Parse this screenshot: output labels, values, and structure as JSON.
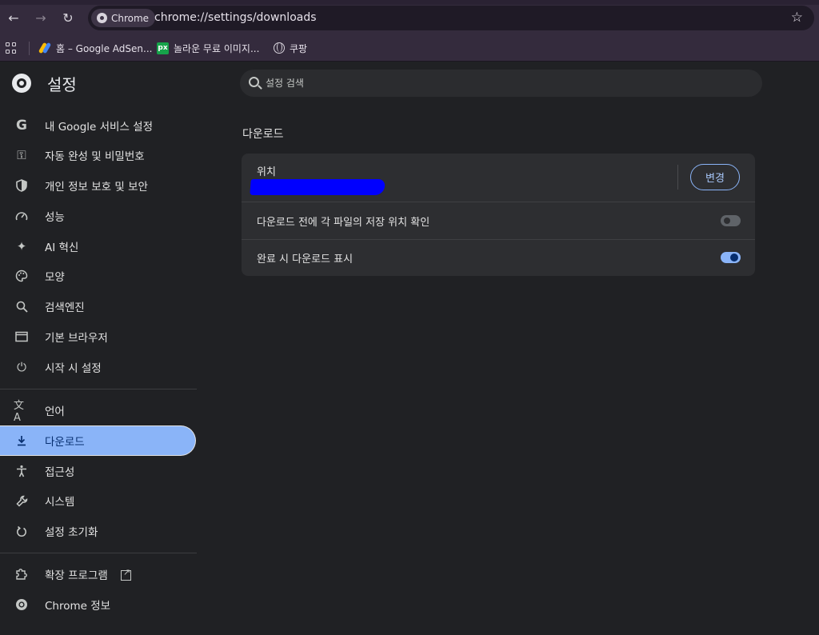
{
  "browser": {
    "chip_label": "Chrome",
    "url": "chrome://settings/downloads",
    "bookmarks": [
      {
        "label": "홈 – Google AdSen...",
        "icon": "google-adsense-icon"
      },
      {
        "label": "놀라운 무료 이미지...",
        "icon": "pixabay-icon",
        "icon_text": "px"
      },
      {
        "label": "쿠팡",
        "icon": "globe-icon"
      }
    ]
  },
  "settings": {
    "title": "설정",
    "search_placeholder": "설정 검색",
    "nav": [
      {
        "label": "내 Google 서비스 설정",
        "icon": "google-icon"
      },
      {
        "label": "자동 완성 및 비밀번호",
        "icon": "key-icon"
      },
      {
        "label": "개인 정보 보호 및 보안",
        "icon": "shield-icon"
      },
      {
        "label": "성능",
        "icon": "speedometer-icon"
      },
      {
        "label": "AI 혁신",
        "icon": "sparkle-icon"
      },
      {
        "label": "모양",
        "icon": "palette-icon"
      },
      {
        "label": "검색엔진",
        "icon": "search-icon"
      },
      {
        "label": "기본 브라우저",
        "icon": "browser-window-icon"
      },
      {
        "label": "시작 시 설정",
        "icon": "power-icon"
      },
      {
        "label": "언어",
        "icon": "translate-icon"
      },
      {
        "label": "다운로드",
        "icon": "download-icon",
        "active": true
      },
      {
        "label": "접근성",
        "icon": "accessibility-icon"
      },
      {
        "label": "시스템",
        "icon": "wrench-icon"
      },
      {
        "label": "설정 초기화",
        "icon": "reset-icon"
      },
      {
        "label": "확장 프로그램",
        "icon": "puzzle-icon"
      },
      {
        "label": "Chrome 정보",
        "icon": "chrome-icon"
      }
    ],
    "section_title": "다운로드",
    "location_label": "위치",
    "change_button": "변경",
    "ask_where_label": "다운로드 전에 각 파일의 저장 위치 확인",
    "ask_where_enabled": false,
    "show_when_done_label": "완료 시 다운로드 표시",
    "show_when_done_enabled": true
  },
  "colors": {
    "accent": "#8ab4f8",
    "background": "#202124",
    "card": "#2d2e31",
    "frame": "#342b3d",
    "redaction": "#0000ff"
  }
}
